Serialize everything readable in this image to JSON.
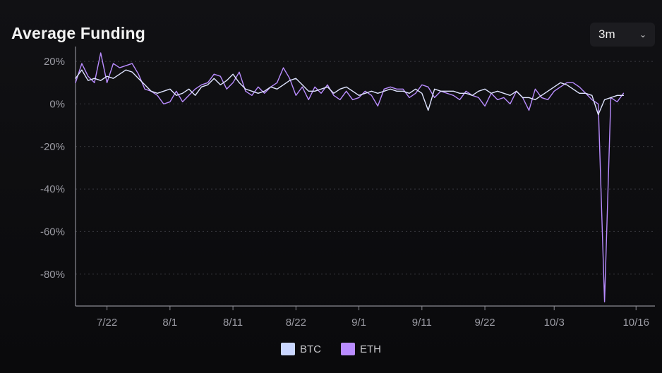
{
  "header": {
    "title": "Average Funding",
    "range_value": "3m",
    "range_chevron_icon": "chevron-down-icon"
  },
  "chart_data": {
    "type": "line",
    "title": "Average Funding",
    "xlabel": "",
    "ylabel": "",
    "ylim": [
      -95,
      25
    ],
    "yticks": [
      20,
      0,
      -20,
      -40,
      -60,
      -80
    ],
    "ytick_labels": [
      "20%",
      "0%",
      "-20%",
      "-40%",
      "-60%",
      "-80%"
    ],
    "xticks": [
      5,
      15,
      25,
      35,
      45,
      55,
      65,
      76,
      89
    ],
    "xtick_labels": [
      "7/22",
      "8/1",
      "8/11",
      "8/22",
      "9/1",
      "9/11",
      "9/22",
      "10/3",
      "10/16"
    ],
    "x_range": [
      0,
      92
    ],
    "grid": true,
    "legend_position": "bottom-center",
    "series": [
      {
        "name": "BTC",
        "color": "#dfe4ff",
        "values": [
          12,
          16,
          11,
          12,
          11,
          13,
          12,
          14,
          16,
          15,
          12,
          9,
          6,
          5,
          6,
          7,
          4,
          5,
          7,
          4,
          8,
          9,
          12,
          9,
          11,
          14,
          10,
          7,
          6,
          5,
          6,
          8,
          7,
          9,
          11,
          12,
          9,
          6,
          6,
          7,
          8,
          5,
          7,
          8,
          6,
          4,
          5,
          6,
          5,
          6,
          7,
          6,
          6,
          5,
          7,
          5,
          -3,
          7,
          6,
          6,
          6,
          5,
          5,
          4,
          6,
          7,
          5,
          6,
          5,
          4,
          6,
          3,
          3,
          2,
          4,
          6,
          8,
          10,
          9,
          7,
          5,
          5,
          4,
          -5,
          2,
          3,
          4,
          4
        ]
      },
      {
        "name": "ETH",
        "color": "#b98cff",
        "values": [
          10,
          19,
          13,
          10,
          24,
          10,
          19,
          17,
          18,
          19,
          14,
          7,
          6,
          4,
          0,
          1,
          6,
          1,
          4,
          7,
          9,
          10,
          14,
          13,
          7,
          10,
          15,
          6,
          4,
          8,
          5,
          8,
          10,
          17,
          12,
          4,
          8,
          2,
          8,
          5,
          9,
          4,
          2,
          6,
          2,
          3,
          6,
          4,
          -1,
          7,
          8,
          7,
          7,
          3,
          5,
          9,
          8,
          3,
          6,
          5,
          4,
          2,
          6,
          4,
          3,
          -1,
          5,
          2,
          3,
          0,
          6,
          3,
          -3,
          7,
          3,
          2,
          6,
          8,
          10,
          10,
          8,
          5,
          2,
          0,
          -93,
          3,
          1,
          5
        ]
      }
    ]
  },
  "legend": {
    "items": [
      {
        "label": "BTC",
        "color": "#c9d6ff"
      },
      {
        "label": "ETH",
        "color": "#b98cff"
      }
    ]
  }
}
